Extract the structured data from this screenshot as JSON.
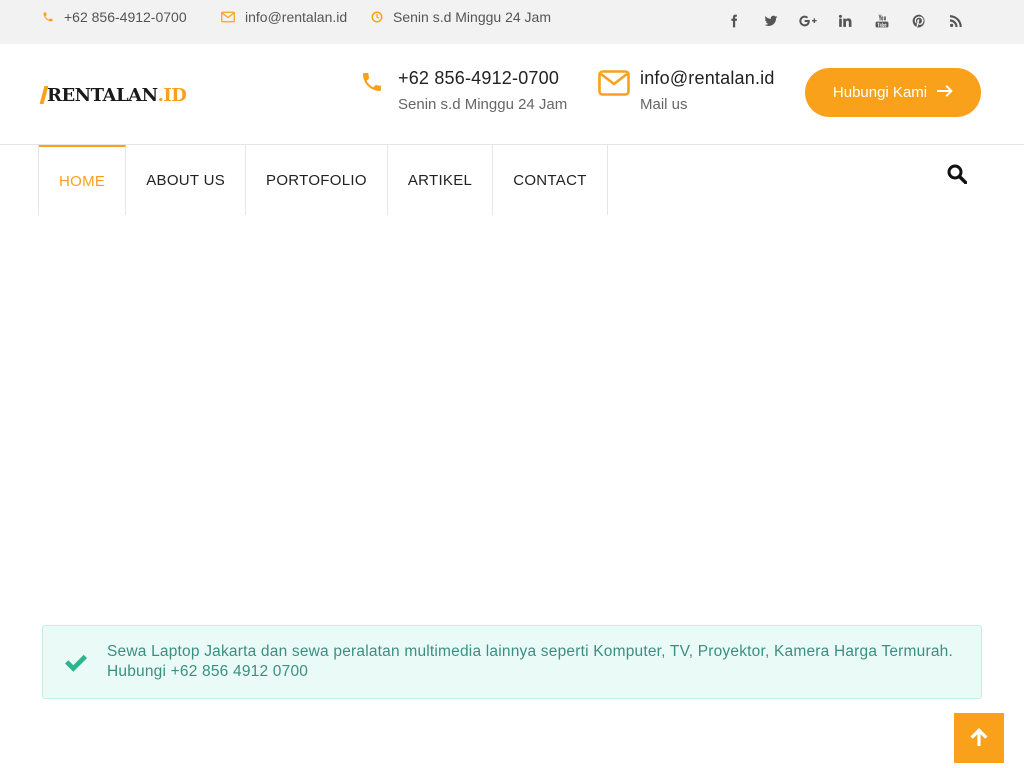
{
  "topbar": {
    "phone": "+62 856-4912-0700",
    "email": "info@rentalan.id",
    "hours": "Senin s.d Minggu 24 Jam",
    "social": [
      {
        "icon": "facebook-icon",
        "glyph": "f"
      },
      {
        "icon": "twitter-icon",
        "glyph": ""
      },
      {
        "icon": "google-plus-icon",
        "glyph": "G+"
      },
      {
        "icon": "linkedin-icon",
        "glyph": "in"
      },
      {
        "icon": "youtube-icon",
        "glyph": ""
      },
      {
        "icon": "pinterest-icon",
        "glyph": ""
      },
      {
        "icon": "rss-icon",
        "glyph": ""
      }
    ]
  },
  "logo": {
    "dark": "RENTALAN",
    "accent": ".ID"
  },
  "header": {
    "phone_main": "+62 856-4912-0700",
    "phone_sub": "Senin s.d Minggu 24 Jam",
    "email_main": "info@rentalan.id",
    "email_sub": "Mail us",
    "cta_label": "Hubungi Kami"
  },
  "nav": {
    "items": [
      "HOME",
      "ABOUT US",
      "PORTOFOLIO",
      "ARTIKEL",
      "CONTACT"
    ],
    "active": "HOME"
  },
  "notice": {
    "text": "Sewa Laptop Jakarta dan sewa peralatan multimedia lainnya seperti Komputer, TV, Proyektor, Kamera Harga Termurah. Hubungi +62 856 4912 0700"
  },
  "colors": {
    "accent": "#f9a11b",
    "notice_bg": "#eafaf7",
    "notice_text": "#3a8f83",
    "check": "#2bb58f"
  }
}
